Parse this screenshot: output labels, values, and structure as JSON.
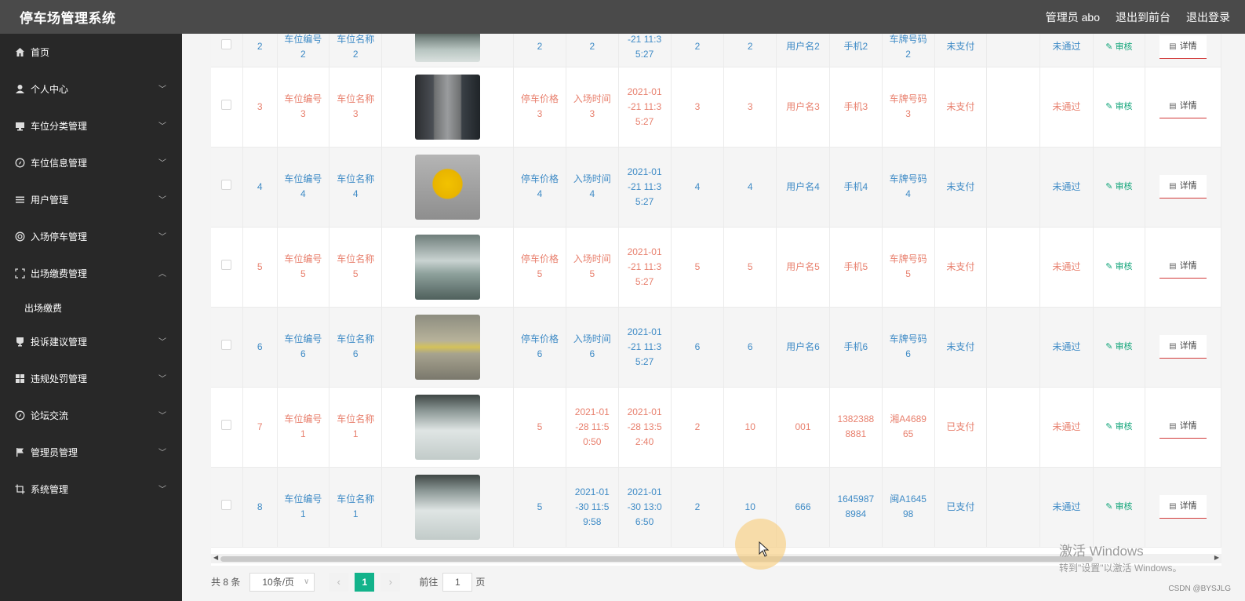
{
  "header": {
    "title": "停车场管理系统",
    "admin": "管理员 abo",
    "front": "退出到前台",
    "logout": "退出登录"
  },
  "sidebar": {
    "items": [
      {
        "label": "首页",
        "icon": "home-icon",
        "chev": ""
      },
      {
        "label": "个人中心",
        "icon": "user-icon",
        "chev": "﹀"
      },
      {
        "label": "车位分类管理",
        "icon": "monitor-icon",
        "chev": "﹀"
      },
      {
        "label": "车位信息管理",
        "icon": "compass-icon",
        "chev": "﹀"
      },
      {
        "label": "用户管理",
        "icon": "list-icon",
        "chev": "﹀"
      },
      {
        "label": "入场停车管理",
        "icon": "lifebuoy-icon",
        "chev": "﹀"
      },
      {
        "label": "出场缴费管理",
        "icon": "fullscreen-icon",
        "chev": "︿"
      }
    ],
    "sub": "出场缴费",
    "items2": [
      {
        "label": "投诉建议管理",
        "icon": "cup-icon",
        "chev": "﹀"
      },
      {
        "label": "违规处罚管理",
        "icon": "grid-icon",
        "chev": "﹀"
      },
      {
        "label": "论坛交流",
        "icon": "compass-icon",
        "chev": "﹀"
      },
      {
        "label": "管理员管理",
        "icon": "flag-icon",
        "chev": "﹀"
      },
      {
        "label": "系统管理",
        "icon": "crop-icon",
        "chev": "﹀"
      }
    ]
  },
  "table": {
    "audit_label": "审核",
    "detail_label": "详情",
    "rows": [
      {
        "idx": "2",
        "code": "车位编号\n2",
        "name": "车位名称\n2",
        "price": "2",
        "intime": "2",
        "outtime": "-21 11:3\n5:27",
        "c1": "2",
        "c2": "2",
        "user": "用户名2",
        "phone": "手机2",
        "plate": "车牌号码\n2",
        "pay": "未支付",
        "review": "未通过",
        "bg": "even",
        "color": "blue"
      },
      {
        "idx": "3",
        "code": "车位编号\n3",
        "name": "车位名称\n3",
        "price": "停车价格\n3",
        "intime": "入场时间\n3",
        "outtime": "2021-01\n-21 11:3\n5:27",
        "c1": "3",
        "c2": "3",
        "user": "用户名3",
        "phone": "手机3",
        "plate": "车牌号码\n3",
        "pay": "未支付",
        "review": "未通过",
        "bg": "odd",
        "color": "red"
      },
      {
        "idx": "4",
        "code": "车位编号\n4",
        "name": "车位名称\n4",
        "price": "停车价格\n4",
        "intime": "入场时间\n4",
        "outtime": "2021-01\n-21 11:3\n5:27",
        "c1": "4",
        "c2": "4",
        "user": "用户名4",
        "phone": "手机4",
        "plate": "车牌号码\n4",
        "pay": "未支付",
        "review": "未通过",
        "bg": "even",
        "color": "blue"
      },
      {
        "idx": "5",
        "code": "车位编号\n5",
        "name": "车位名称\n5",
        "price": "停车价格\n5",
        "intime": "入场时间\n5",
        "outtime": "2021-01\n-21 11:3\n5:27",
        "c1": "5",
        "c2": "5",
        "user": "用户名5",
        "phone": "手机5",
        "plate": "车牌号码\n5",
        "pay": "未支付",
        "review": "未通过",
        "bg": "odd",
        "color": "red"
      },
      {
        "idx": "6",
        "code": "车位编号\n6",
        "name": "车位名称\n6",
        "price": "停车价格\n6",
        "intime": "入场时间\n6",
        "outtime": "2021-01\n-21 11:3\n5:27",
        "c1": "6",
        "c2": "6",
        "user": "用户名6",
        "phone": "手机6",
        "plate": "车牌号码\n6",
        "pay": "未支付",
        "review": "未通过",
        "bg": "even",
        "color": "blue"
      },
      {
        "idx": "7",
        "code": "车位编号\n1",
        "name": "车位名称\n1",
        "price": "5",
        "intime": "2021-01\n-28 11:5\n0:50",
        "outtime": "2021-01\n-28 13:5\n2:40",
        "c1": "2",
        "c2": "10",
        "user": "001",
        "phone": "1382388\n8881",
        "plate": "湘A4689\n65",
        "pay": "已支付",
        "review": "未通过",
        "bg": "odd",
        "color": "red"
      },
      {
        "idx": "8",
        "code": "车位编号\n1",
        "name": "车位名称\n1",
        "price": "5",
        "intime": "2021-01\n-30 11:5\n9:58",
        "outtime": "2021-01\n-30 13:0\n6:50",
        "c1": "2",
        "c2": "10",
        "user": "666",
        "phone": "1645987\n8984",
        "plate": "闽A1645\n98",
        "pay": "已支付",
        "review": "未通过",
        "bg": "even",
        "color": "blue"
      }
    ]
  },
  "pager": {
    "total": "共 8 条",
    "size": "10条/页",
    "current": "1",
    "goto": "前往",
    "page": "1",
    "unit": "页"
  },
  "watermark": {
    "line1": "激活 Windows",
    "line2": "转到\"设置\"以激活 Windows。"
  },
  "credit": "CSDN @BYSJLG"
}
